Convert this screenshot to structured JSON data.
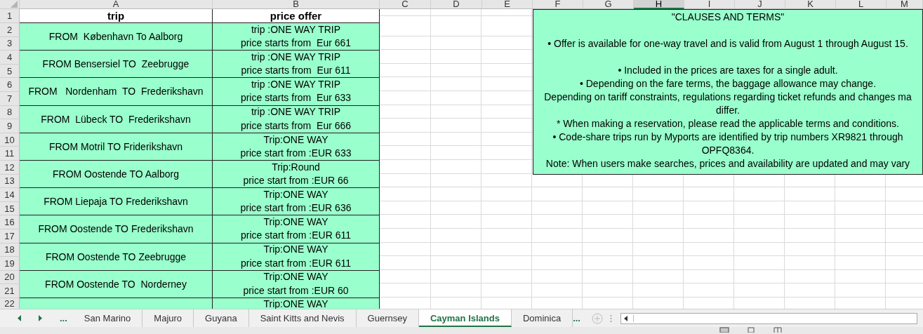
{
  "column_headers": [
    {
      "label": "A",
      "selected": false
    },
    {
      "label": "B",
      "selected": false
    },
    {
      "label": "C",
      "selected": false
    },
    {
      "label": "D",
      "selected": false
    },
    {
      "label": "E",
      "selected": false
    },
    {
      "label": "F",
      "selected": false
    },
    {
      "label": "G",
      "selected": false
    },
    {
      "label": "H",
      "selected": true
    },
    {
      "label": "I",
      "selected": false
    },
    {
      "label": "J",
      "selected": false
    },
    {
      "label": "K",
      "selected": false
    },
    {
      "label": "L",
      "selected": false
    },
    {
      "label": "M",
      "selected": false
    }
  ],
  "row_numbers": [
    "1",
    "2",
    "3",
    "4",
    "5",
    "6",
    "7",
    "8",
    "9",
    "10",
    "11",
    "12",
    "13",
    "14",
    "15",
    "16",
    "17",
    "18",
    "19",
    "20",
    "21",
    "22"
  ],
  "table": {
    "columns": [
      "trip",
      "price offer"
    ],
    "rows": [
      {
        "trip": "FROM  København To Aalborg",
        "offer": [
          "trip :ONE WAY TRIP",
          "price starts from  Eur 661"
        ]
      },
      {
        "trip": "FROM Bensersiel TO  Zeebrugge",
        "offer": [
          "trip :ONE WAY TRIP",
          "price starts from  Eur 611"
        ]
      },
      {
        "trip": "FROM   Nordenham  TO  Frederikshavn",
        "offer": [
          "trip :ONE WAY TRIP",
          "price starts from  Eur 633"
        ]
      },
      {
        "trip": "FROM  Lübeck TO  Frederikshavn",
        "offer": [
          "trip :ONE WAY TRIP",
          "price starts from  Eur 666"
        ]
      },
      {
        "trip": "FROM Motril TO Friderikshavn",
        "offer": [
          "Trip:ONE WAY",
          "price start from :EUR 633"
        ]
      },
      {
        "trip": "FROM Oostende TO Aalborg",
        "offer": [
          "Trip:Round",
          "price start from :EUR 66"
        ]
      },
      {
        "trip": "FROM Liepaja TO Frederikshavn",
        "offer": [
          "Trip:ONE WAY",
          "price start from :EUR 636"
        ]
      },
      {
        "trip": "FROM Oostende TO Frederikshavn",
        "offer": [
          "Trip:ONE WAY",
          "price start from :EUR 611"
        ]
      },
      {
        "trip": "FROM Oostende TO Zeebrugge",
        "offer": [
          "Trip:ONE WAY",
          "price start from :EUR 611"
        ]
      },
      {
        "trip": "FROM Oostende TO  Norderney",
        "offer": [
          "Trip:ONE WAY",
          "price start from :EUR 60"
        ]
      }
    ],
    "partial_row": {
      "offer": "Trip:ONE WAY"
    }
  },
  "terms": {
    "title": "\"CLAUSES AND TERMS\"",
    "paragraphs": [
      [
        "• Offer is available for one-way travel and is valid from August 1 through August 15."
      ],
      [
        "• Included in the prices are taxes for a single adult.",
        "• Depending on the fare terms, the baggage allowance may change.",
        "Depending on tariff constraints, regulations regarding ticket refunds and changes ma",
        "differ.",
        "* When making a reservation, please read the applicable terms and conditions.",
        "• Code-share trips run by Myports are identified by trip numbers XR9821 through",
        "OPFQ8364.",
        "Note: When users make searches, prices and availability are updated and may vary"
      ]
    ]
  },
  "sheet_tabs": [
    {
      "label": "San Marino",
      "selected": false
    },
    {
      "label": "Majuro",
      "selected": false
    },
    {
      "label": "Guyana",
      "selected": false
    },
    {
      "label": "Saint Kitts and Nevis",
      "selected": false
    },
    {
      "label": "Guernsey",
      "selected": false
    },
    {
      "label": "Cayman Islands",
      "selected": true
    },
    {
      "label": "Dominica",
      "selected": false
    }
  ],
  "tab_overflow_left": "...",
  "tab_overflow_right": "..."
}
